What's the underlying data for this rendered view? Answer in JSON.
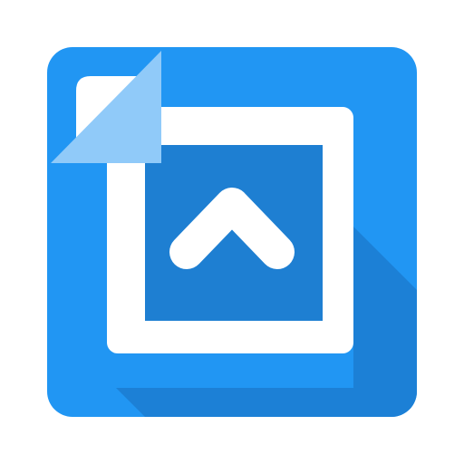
{
  "app_icon": {
    "icon": "move-up-app-icon",
    "colors": {
      "tile_top": "#2196f3",
      "tile_shadow": "#1c80d6",
      "frame": "#ffffff",
      "inner": "#1e7fd2",
      "page_corner": "#90caf9",
      "chevron": "#ffffff"
    }
  }
}
